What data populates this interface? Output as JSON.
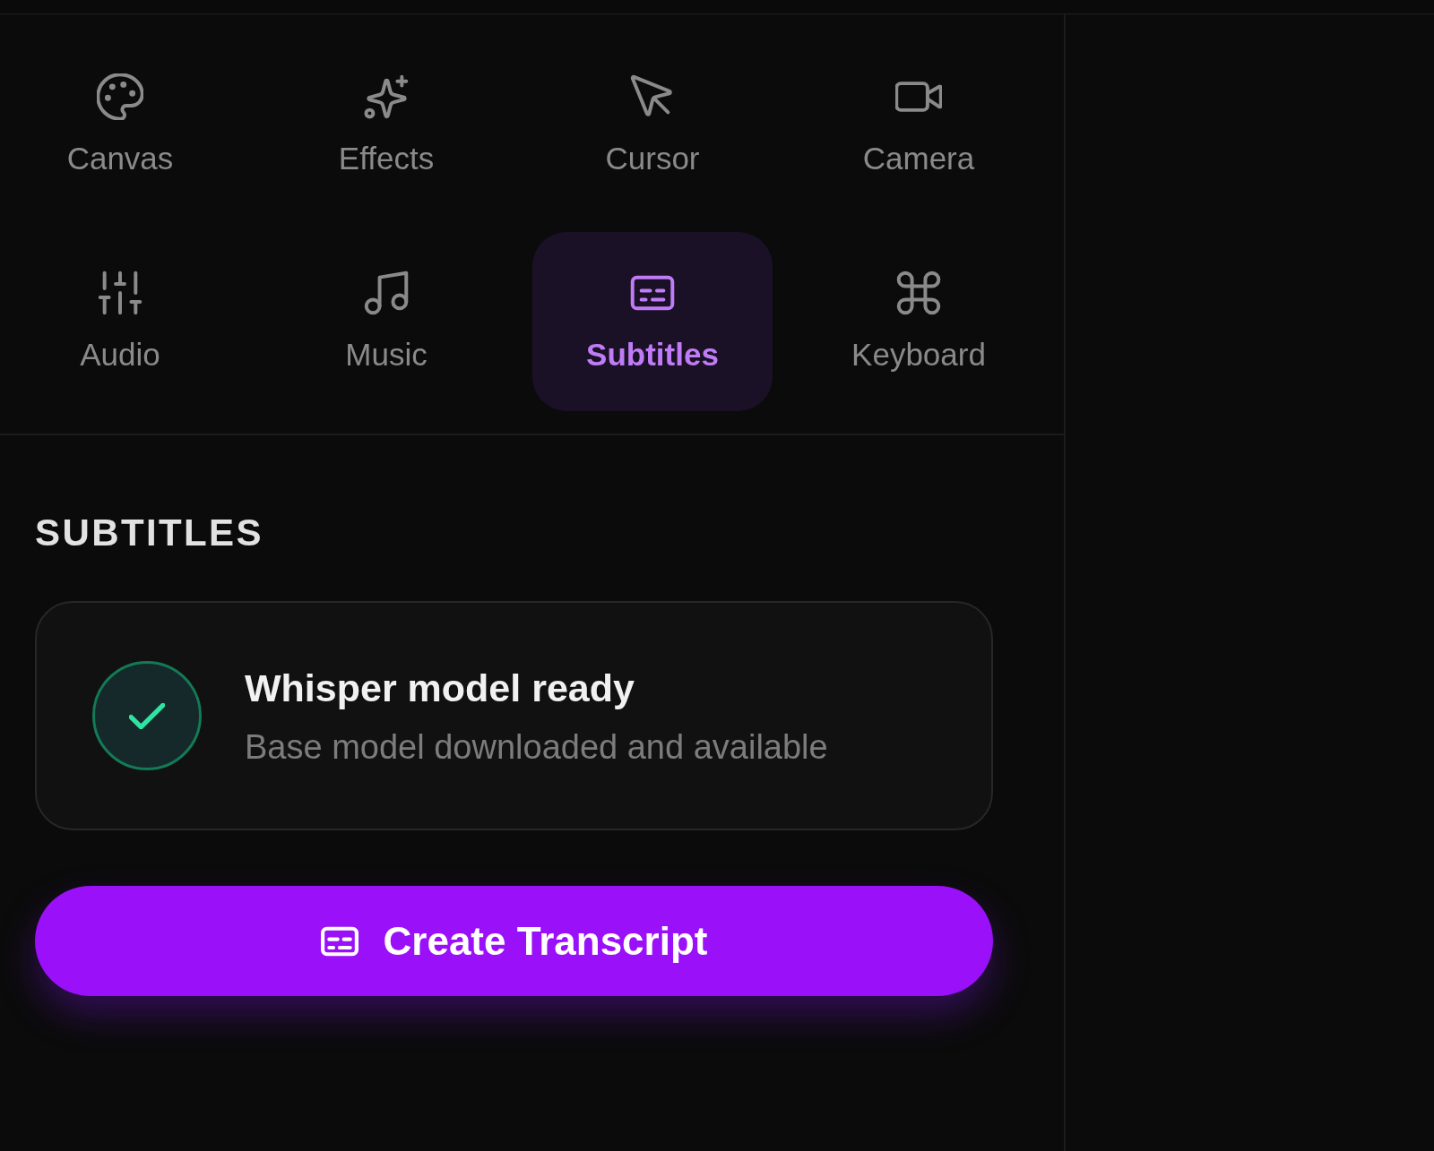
{
  "tabs": [
    {
      "label": "Canvas",
      "selected": false
    },
    {
      "label": "Effects",
      "selected": false
    },
    {
      "label": "Cursor",
      "selected": false
    },
    {
      "label": "Camera",
      "selected": false
    },
    {
      "label": "Audio",
      "selected": false
    },
    {
      "label": "Music",
      "selected": false
    },
    {
      "label": "Subtitles",
      "selected": true
    },
    {
      "label": "Keyboard",
      "selected": false
    }
  ],
  "section": {
    "heading": "SUBTITLES",
    "status_card": {
      "ready": true,
      "title": "Whisper model ready",
      "description": "Base model downloaded and available"
    },
    "action_button": {
      "label": "Create Transcript"
    }
  }
}
